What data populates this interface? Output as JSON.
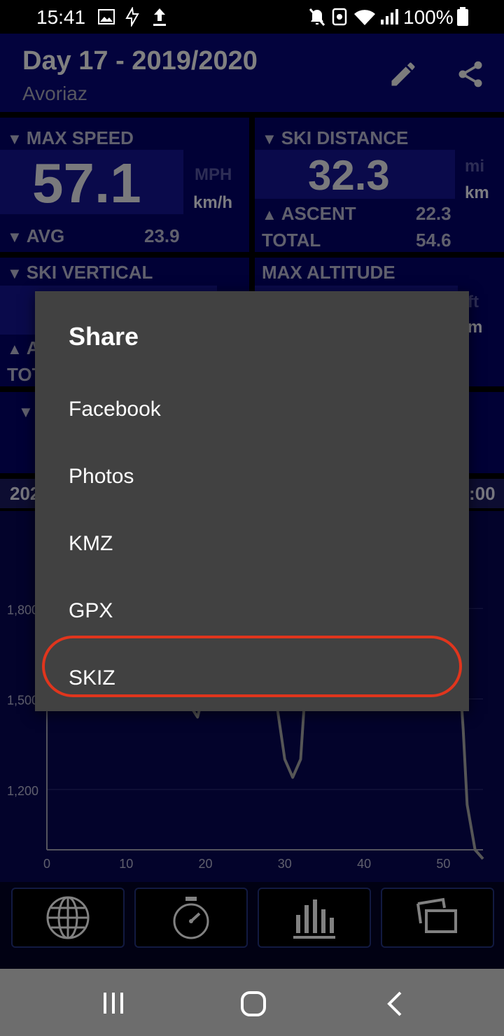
{
  "status_bar": {
    "time": "15:41",
    "battery": "100%"
  },
  "header": {
    "title": "Day 17 - 2019/2020",
    "subtitle": "Avoriaz"
  },
  "tiles": {
    "max_speed": {
      "label": "MAX SPEED",
      "value": "57.1",
      "unit_inactive": "MPH",
      "unit_active": "km/h",
      "avg_label": "AVG",
      "avg_value": "23.9"
    },
    "ski_distance": {
      "label": "SKI DISTANCE",
      "value": "32.3",
      "unit_inactive": "mi",
      "unit_active": "km",
      "ascent_label": "ASCENT",
      "ascent_value": "22.3",
      "total_label": "TOTAL",
      "total_value": "54.6"
    },
    "ski_vertical": {
      "label": "SKI VERTICAL",
      "partial_a": "A",
      "partial_tot": "TOT"
    },
    "max_altitude": {
      "label": "MAX ALTITUDE",
      "unit_inactive": "ft",
      "unit_active": "m"
    }
  },
  "strip": {
    "left_text": "202",
    "right_text": ":00"
  },
  "chart_data": {
    "type": "line",
    "x_ticks": [
      0,
      10,
      20,
      30,
      40,
      50
    ],
    "y_ticks": [
      "1,800",
      "1,500",
      "1,200"
    ],
    "xlim": [
      0,
      55
    ],
    "ylim": [
      1000,
      2100
    ],
    "x": [
      0,
      0.5,
      1,
      2,
      3,
      4,
      9,
      10,
      11,
      12,
      17,
      18,
      19,
      20,
      21,
      21.5,
      22,
      23,
      29,
      30,
      31,
      32,
      33,
      40,
      41,
      42,
      43,
      52,
      52.5,
      53,
      54,
      55
    ],
    "y": [
      1600,
      1480,
      1480,
      1550,
      1700,
      1820,
      1600,
      1470,
      1560,
      1800,
      1560,
      1480,
      1440,
      1540,
      1560,
      1520,
      1560,
      1700,
      1480,
      1300,
      1240,
      1300,
      1700,
      1560,
      1530,
      1560,
      1700,
      1600,
      1400,
      1150,
      1000,
      970
    ]
  },
  "share_dialog": {
    "title": "Share",
    "options": [
      "Facebook",
      "Photos",
      "KMZ",
      "GPX",
      "SKIZ"
    ]
  },
  "colors": {
    "highlight": "#e0351d",
    "header_bg": "#050563",
    "dialog_bg": "#414141"
  },
  "toolbar_icons": [
    "globe-icon",
    "stopwatch-icon",
    "bar-chart-icon",
    "photos-icon"
  ]
}
